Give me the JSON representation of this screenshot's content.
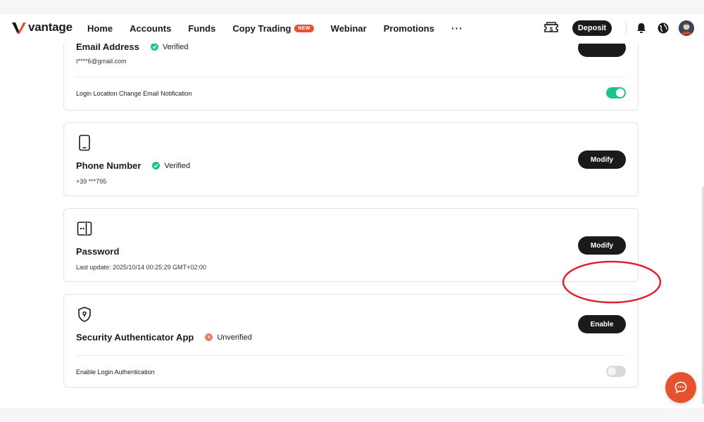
{
  "brand": {
    "name": "vantage",
    "accent": "#e4532d",
    "success": "#1ec28b",
    "warning": "#f07c64"
  },
  "nav": {
    "items": [
      {
        "label": "Home"
      },
      {
        "label": "Accounts"
      },
      {
        "label": "Funds"
      },
      {
        "label": "Copy Trading",
        "badge": "NEW"
      },
      {
        "label": "Webinar"
      },
      {
        "label": "Promotions"
      }
    ],
    "more_label": "···",
    "deposit_label": "Deposit",
    "icons": [
      "ticket-dollar-icon",
      "bell-icon",
      "globe-icon",
      "avatar"
    ]
  },
  "email_card": {
    "title_partial": "Email Address",
    "status": "Verified",
    "value": "t****6@gmail.com",
    "notification_label": "Login Location Change Email Notification",
    "notification_enabled": true
  },
  "phone_card": {
    "icon": "phone-icon",
    "title": "Phone Number",
    "status": "Verified",
    "value": "+39 ***795",
    "button": "Modify"
  },
  "password_card": {
    "icon": "password-icon",
    "title": "Password",
    "sub": "Last update: 2025/10/14 00:25:29 GMT+02:00",
    "button": "Modify"
  },
  "auth_card": {
    "icon": "shield-icon",
    "title": "Security Authenticator App",
    "status": "Unverified",
    "button": "Enable",
    "login_auth_label": "Enable Login Authentication",
    "login_auth_enabled": false
  },
  "chat": {
    "icon": "chat-icon"
  }
}
